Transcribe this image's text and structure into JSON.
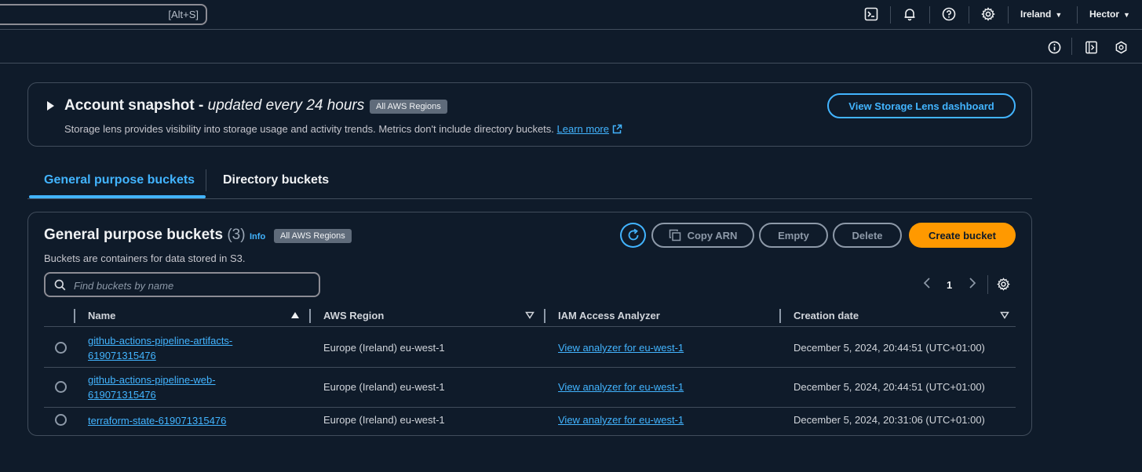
{
  "topnav": {
    "search_shortcut": "[Alt+S]",
    "region": "Ireland",
    "user": "Hector"
  },
  "snapshot": {
    "title_bold": "Account snapshot - ",
    "title_italic": "updated every 24 hours",
    "badge": "All AWS Regions",
    "description": "Storage lens provides visibility into storage usage and activity trends. Metrics don't include directory buckets. ",
    "learn_more": "Learn more",
    "button": "View Storage Lens dashboard"
  },
  "tabs": {
    "general": "General purpose buckets",
    "directory": "Directory buckets"
  },
  "panel": {
    "title": "General purpose buckets",
    "count": "(3)",
    "info": "Info",
    "badge": "All AWS Regions",
    "description": "Buckets are containers for data stored in S3.",
    "copy_arn": "Copy ARN",
    "empty": "Empty",
    "delete": "Delete",
    "create": "Create bucket",
    "search_placeholder": "Find buckets by name",
    "page": "1"
  },
  "table": {
    "columns": [
      "Name",
      "AWS Region",
      "IAM Access Analyzer",
      "Creation date"
    ],
    "rows": [
      {
        "name": "github-actions-pipeline-artifacts-619071315476",
        "name_line1": "github-actions-pipeline-artifacts-",
        "name_line2": "619071315476",
        "region": "Europe (Ireland) eu-west-1",
        "analyzer": "View analyzer for eu-west-1",
        "created": "December 5, 2024, 20:44:51 (UTC+01:00)"
      },
      {
        "name": "github-actions-pipeline-web-619071315476",
        "name_line1": "github-actions-pipeline-web-",
        "name_line2": "619071315476",
        "region": "Europe (Ireland) eu-west-1",
        "analyzer": "View analyzer for eu-west-1",
        "created": "December 5, 2024, 20:44:51 (UTC+01:00)"
      },
      {
        "name": "terraform-state-619071315476",
        "name_line1": "terraform-state-619071315476",
        "name_line2": "",
        "region": "Europe (Ireland) eu-west-1",
        "analyzer": "View analyzer for eu-west-1",
        "created": "December 5, 2024, 20:31:06 (UTC+01:00)"
      }
    ]
  },
  "colors": {
    "background": "#0f1b2a",
    "accent": "#42b4ff",
    "primary_button": "#ff9900",
    "border": "#414d5c"
  }
}
